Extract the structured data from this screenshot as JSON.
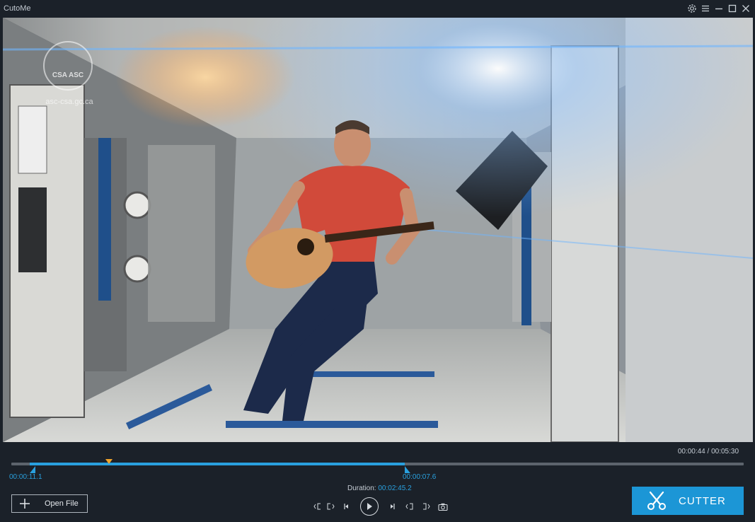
{
  "app": {
    "title": "CutoMe"
  },
  "window_controls": [
    "settings-icon",
    "menu-icon",
    "minimize-icon",
    "maximize-icon",
    "close-icon"
  ],
  "video": {
    "watermark_logo": "CSA ASC",
    "watermark_url": "asc-csa.gc.ca"
  },
  "timeline": {
    "current_and_total": "00:00:44 / 00:05:30",
    "trim_start": "00:00:11.1",
    "trim_end": "00:00:07.6",
    "duration_label": "Duration:",
    "duration_value": "00:02:45.2",
    "playhead_position": 0.133,
    "trim_start_position": 0.025,
    "trim_end_position": 0.537
  },
  "controls": {
    "open_file_label": "Open File",
    "buttons": [
      "set-start-icon",
      "go-to-start-icon",
      "prev-frame-icon",
      "play-icon",
      "next-frame-icon",
      "go-to-end-icon",
      "set-end-icon",
      "snapshot-icon"
    ]
  },
  "cutter": {
    "label": "CUTTER"
  },
  "colors": {
    "accent": "#29a0de",
    "playhead": "#f1a42b",
    "background": "#1b2129",
    "button": "#1c96d6"
  }
}
